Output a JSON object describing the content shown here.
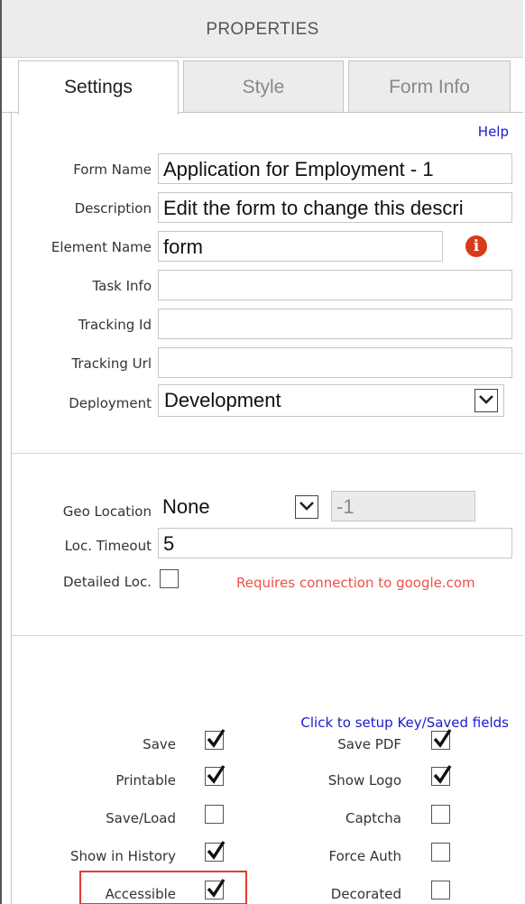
{
  "panel": {
    "title": "PROPERTIES"
  },
  "tabs": [
    {
      "label": "Settings",
      "active": true
    },
    {
      "label": "Style",
      "active": false
    },
    {
      "label": "Form Info",
      "active": false
    }
  ],
  "help_link": "Help",
  "fields": {
    "form_name": {
      "label": "Form Name",
      "value": "Application for Employment - 1"
    },
    "description": {
      "label": "Description",
      "value": "Edit the form to change this descri"
    },
    "element_name": {
      "label": "Element Name",
      "value": "form"
    },
    "task_info": {
      "label": "Task Info",
      "value": ""
    },
    "tracking_id": {
      "label": "Tracking Id",
      "value": ""
    },
    "tracking_url": {
      "label": "Tracking Url",
      "value": ""
    },
    "deployment": {
      "label": "Deployment",
      "value": "Development"
    }
  },
  "geo": {
    "location_label": "Geo Location",
    "location_value": "None",
    "location_extra": "-1",
    "timeout_label": "Loc. Timeout",
    "timeout_value": "5",
    "detailed_label": "Detailed Loc.",
    "detailed_checked": false,
    "warning": "Requires connection to google.com"
  },
  "key_fields_link": "Click to setup Key/Saved fields",
  "options_left": [
    {
      "label": "Save",
      "checked": true
    },
    {
      "label": "Printable",
      "checked": true
    },
    {
      "label": "Save/Load",
      "checked": false
    },
    {
      "label": "Show in History",
      "checked": true
    },
    {
      "label": "Accessible",
      "checked": true
    }
  ],
  "options_right": [
    {
      "label": "Save PDF",
      "checked": true
    },
    {
      "label": "Show Logo",
      "checked": true
    },
    {
      "label": "Captcha",
      "checked": false
    },
    {
      "label": "Force Auth",
      "checked": false
    },
    {
      "label": "Decorated",
      "checked": false
    }
  ],
  "colors": {
    "link": "#1a1acd",
    "warning": "#e8524a",
    "info_icon": "#d83a1a",
    "highlight": "#e53935"
  }
}
